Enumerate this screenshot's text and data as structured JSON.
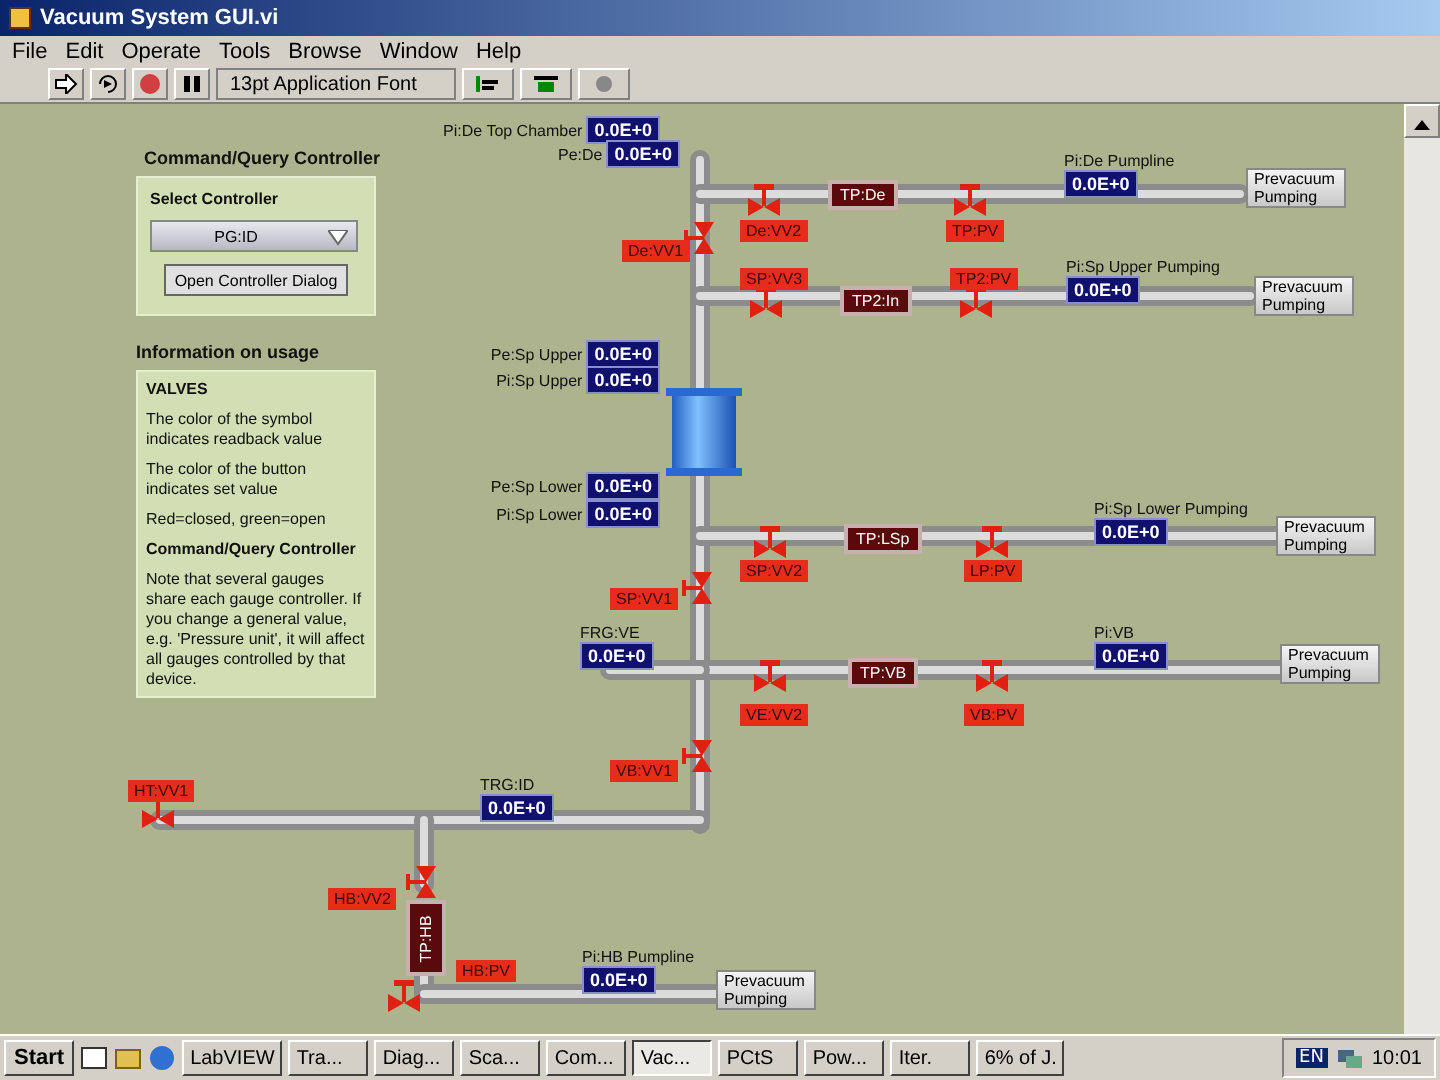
{
  "window": {
    "title": "Vacuum System GUI.vi"
  },
  "menu": [
    "File",
    "Edit",
    "Operate",
    "Tools",
    "Browse",
    "Window",
    "Help"
  ],
  "toolbar": {
    "font": "13pt Application Font"
  },
  "controller_panel": {
    "heading": "Command/Query Controller",
    "select_label": "Select Controller",
    "selected_controller": "PG:ID",
    "button": "Open Controller Dialog"
  },
  "info_panel": {
    "heading": "Information on usage",
    "paragraphs": [
      {
        "text": "VALVES",
        "bold": true
      },
      {
        "text": "The color of the symbol indicates readback value",
        "bold": false
      },
      {
        "text": "The color of the button indicates set value",
        "bold": false
      },
      {
        "text": "Red=closed, green=open",
        "bold": false
      },
      {
        "text": "Command/Query Controller",
        "bold": true
      },
      {
        "text": "Note that several gauges share each gauge controller. If you change a general value, e.g. 'Pressure unit', it will affect all gauges controlled by that device.",
        "bold": false
      }
    ]
  },
  "gauges": [
    {
      "label": "Pi:De Top Chamber",
      "value": "0.0E+0"
    },
    {
      "label": "Pe:De",
      "value": "0.0E+0"
    },
    {
      "label": "Pi:De Pumpline",
      "value": "0.0E+0"
    },
    {
      "label": "Pi:Sp Upper Pumping",
      "value": "0.0E+0"
    },
    {
      "label": "Pe:Sp Upper",
      "value": "0.0E+0"
    },
    {
      "label": "Pi:Sp Upper",
      "value": "0.0E+0"
    },
    {
      "label": "Pe:Sp Lower",
      "value": "0.0E+0"
    },
    {
      "label": "Pi:Sp Lower",
      "value": "0.0E+0"
    },
    {
      "label": "Pi:Sp Lower Pumping",
      "value": "0.0E+0"
    },
    {
      "label": "FRG:VE",
      "value": "0.0E+0"
    },
    {
      "label": "Pi:VB",
      "value": "0.0E+0"
    },
    {
      "label": "TRG:ID",
      "value": "0.0E+0"
    },
    {
      "label": "Pi:HB Pumpline",
      "value": "0.0E+0"
    }
  ],
  "pumps": [
    {
      "label": "TP:De",
      "kind": "horizontal"
    },
    {
      "label": "TP2:In",
      "kind": "horizontal"
    },
    {
      "label": "TP:LSp",
      "kind": "horizontal"
    },
    {
      "label": "TP:VB",
      "kind": "horizontal"
    },
    {
      "label": "TP:HB",
      "kind": "vertical"
    }
  ],
  "valves": [
    {
      "label": "De:VV2",
      "kind": "horizontal",
      "open": false
    },
    {
      "label": "TP:PV",
      "kind": "horizontal",
      "open": false
    },
    {
      "label": "De:VV1",
      "kind": "vertical",
      "open": false
    },
    {
      "label": "SP:VV3",
      "kind": "horizontal",
      "open": false
    },
    {
      "label": "TP2:PV",
      "kind": "horizontal",
      "open": false
    },
    {
      "label": "SP:VV2",
      "kind": "horizontal",
      "open": false
    },
    {
      "label": "LP:PV",
      "kind": "horizontal",
      "open": false
    },
    {
      "label": "SP:VV1",
      "kind": "vertical",
      "open": false
    },
    {
      "label": "VE:VV2",
      "kind": "horizontal",
      "open": false
    },
    {
      "label": "VB:PV",
      "kind": "horizontal",
      "open": false
    },
    {
      "label": "VB:VV1",
      "kind": "vertical",
      "open": false
    },
    {
      "label": "HT:VV1",
      "kind": "horizontal",
      "open": false
    },
    {
      "label": "HB:VV2",
      "kind": "vertical",
      "open": false
    },
    {
      "label": "HB:PV",
      "kind": "horizontal",
      "open": false
    }
  ],
  "prevacuum_buttons": [
    "Prevacuum Pumping",
    "Prevacuum Pumping",
    "Prevacuum Pumping",
    "Prevacuum Pumping",
    "Prevacuum Pumping"
  ],
  "taskbar": {
    "start": "Start",
    "tasks": [
      {
        "label": "LabVIEW",
        "selected": false
      },
      {
        "label": "Tra...",
        "selected": false
      },
      {
        "label": "Diag...",
        "selected": false
      },
      {
        "label": "Sca...",
        "selected": false
      },
      {
        "label": "Com...",
        "selected": false
      },
      {
        "label": "Vac...",
        "selected": true
      },
      {
        "label": "PCtS",
        "selected": false
      },
      {
        "label": "Pow...",
        "selected": false
      },
      {
        "label": "Iter.",
        "selected": false
      },
      {
        "label": "6% of J.",
        "selected": false
      }
    ],
    "language": "EN",
    "clock": "10:01"
  }
}
